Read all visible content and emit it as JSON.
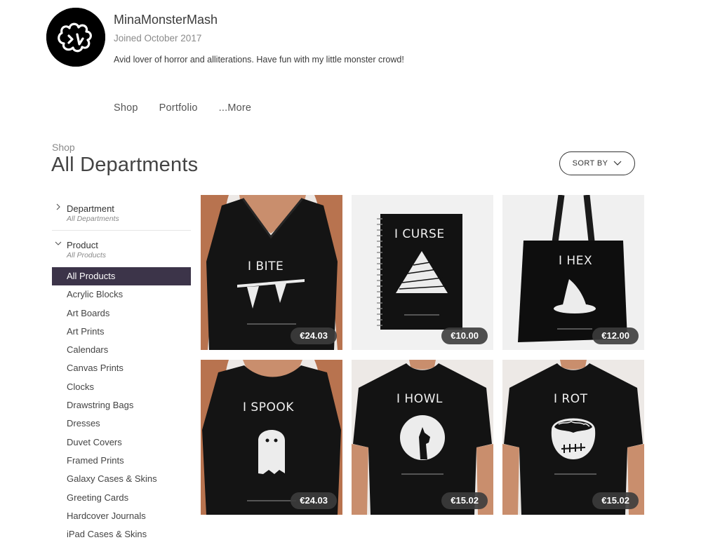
{
  "profile": {
    "name": "MinaMonsterMash",
    "joined": "Joined October 2017",
    "bio": "Avid lover of horror and alliterations. Have fun with my little monster crowd!"
  },
  "nav": {
    "shop": "Shop",
    "portfolio": "Portfolio",
    "more": "...More"
  },
  "page": {
    "crumb": "Shop",
    "title": "All Departments",
    "sort_label": "SORT BY"
  },
  "filters": {
    "department": {
      "title": "Department",
      "value": "All Departments"
    },
    "product": {
      "title": "Product",
      "value": "All Products"
    },
    "items": [
      "All Products",
      "Acrylic Blocks",
      "Art Boards",
      "Art Prints",
      "Calendars",
      "Canvas Prints",
      "Clocks",
      "Drawstring Bags",
      "Dresses",
      "Duvet Covers",
      "Framed Prints",
      "Galaxy Cases & Skins",
      "Greeting Cards",
      "Hardcover Journals",
      "iPad Cases & Skins"
    ],
    "active_index": 0
  },
  "products": [
    {
      "title": "I BITE",
      "price": "€24.03",
      "kind": "vneck-tee",
      "art": "fangs-icon"
    },
    {
      "title": "I CURSE",
      "price": "€10.00",
      "kind": "notebook",
      "art": "pyramid-icon"
    },
    {
      "title": "I HEX",
      "price": "€12.00",
      "kind": "tote-bag",
      "art": "witch-hat-icon"
    },
    {
      "title": "I SPOOK",
      "price": "€24.03",
      "kind": "relaxed-tee",
      "art": "ghost-icon"
    },
    {
      "title": "I HOWL",
      "price": "€15.02",
      "kind": "tshirt",
      "art": "wolf-moon-icon"
    },
    {
      "title": "I ROT",
      "price": "€15.02",
      "kind": "tshirt",
      "art": "zombie-brain-icon"
    }
  ],
  "colors": {
    "active_filter_bg": "#3c3449",
    "price_badge_bg": "#3c3c3c",
    "garment": "#111111"
  }
}
